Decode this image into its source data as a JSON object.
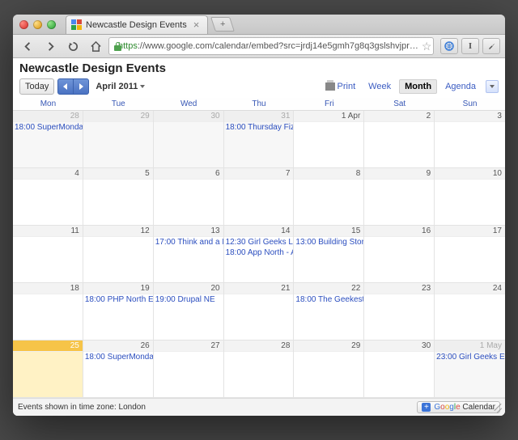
{
  "browser": {
    "tab_title": "Newcastle Design Events",
    "url_scheme": "https",
    "url_rest": "://www.google.com/calendar/embed?src=jrdj14e5gmh7g8q3gslshvjpr…",
    "ext_icons": [
      "globe-icon",
      "serif-i-icon",
      "wrench-icon"
    ]
  },
  "calendar": {
    "title": "Newcastle Design Events",
    "today_label": "Today",
    "month_label": "April 2011",
    "print_label": "Print",
    "views": {
      "week": "Week",
      "month": "Month",
      "agenda": "Agenda"
    },
    "active_view": "Month",
    "dow": [
      "Mon",
      "Tue",
      "Wed",
      "Thu",
      "Fri",
      "Sat",
      "Sun"
    ],
    "footer": "Events shown in time zone: London",
    "gcal_button_word": "Calendar",
    "grid": [
      {
        "date": "28",
        "out": true,
        "today": false,
        "events": [
          {
            "time": "18:00",
            "title": "SuperMonday"
          }
        ]
      },
      {
        "date": "29",
        "out": true,
        "today": false,
        "events": []
      },
      {
        "date": "30",
        "out": true,
        "today": false,
        "events": []
      },
      {
        "date": "31",
        "out": true,
        "today": false,
        "events": [
          {
            "time": "18:00",
            "title": "Thursday Fizz"
          }
        ]
      },
      {
        "date": "1 Apr",
        "out": false,
        "today": false,
        "events": []
      },
      {
        "date": "2",
        "out": false,
        "today": false,
        "events": []
      },
      {
        "date": "3",
        "out": false,
        "today": false,
        "events": []
      },
      {
        "date": "4",
        "out": false,
        "today": false,
        "events": []
      },
      {
        "date": "5",
        "out": false,
        "today": false,
        "events": []
      },
      {
        "date": "6",
        "out": false,
        "today": false,
        "events": []
      },
      {
        "date": "7",
        "out": false,
        "today": false,
        "events": []
      },
      {
        "date": "8",
        "out": false,
        "today": false,
        "events": []
      },
      {
        "date": "9",
        "out": false,
        "today": false,
        "events": []
      },
      {
        "date": "10",
        "out": false,
        "today": false,
        "events": []
      },
      {
        "date": "11",
        "out": false,
        "today": false,
        "events": []
      },
      {
        "date": "12",
        "out": false,
        "today": false,
        "events": []
      },
      {
        "date": "13",
        "out": false,
        "today": false,
        "events": [
          {
            "time": "17:00",
            "title": "Think and a Drink"
          }
        ]
      },
      {
        "date": "14",
        "out": false,
        "today": false,
        "events": [
          {
            "time": "12:30",
            "title": "Girl Geeks Lunch"
          },
          {
            "time": "18:00",
            "title": "App North - A"
          }
        ]
      },
      {
        "date": "15",
        "out": false,
        "today": false,
        "events": [
          {
            "time": "13:00",
            "title": "Building Store"
          }
        ]
      },
      {
        "date": "16",
        "out": false,
        "today": false,
        "events": []
      },
      {
        "date": "17",
        "out": false,
        "today": false,
        "events": []
      },
      {
        "date": "18",
        "out": false,
        "today": false,
        "events": []
      },
      {
        "date": "19",
        "out": false,
        "today": false,
        "events": [
          {
            "time": "18:00",
            "title": "PHP North East"
          }
        ]
      },
      {
        "date": "20",
        "out": false,
        "today": false,
        "events": [
          {
            "time": "19:00",
            "title": "Drupal NE"
          }
        ]
      },
      {
        "date": "21",
        "out": false,
        "today": false,
        "events": []
      },
      {
        "date": "22",
        "out": false,
        "today": false,
        "events": [
          {
            "time": "18:00",
            "title": "The Geekest"
          }
        ]
      },
      {
        "date": "23",
        "out": false,
        "today": false,
        "events": []
      },
      {
        "date": "24",
        "out": false,
        "today": false,
        "events": []
      },
      {
        "date": "25",
        "out": false,
        "today": true,
        "events": []
      },
      {
        "date": "26",
        "out": false,
        "today": false,
        "events": [
          {
            "time": "18:00",
            "title": "SuperMonday"
          }
        ]
      },
      {
        "date": "27",
        "out": false,
        "today": false,
        "events": []
      },
      {
        "date": "28",
        "out": false,
        "today": false,
        "events": []
      },
      {
        "date": "29",
        "out": false,
        "today": false,
        "events": []
      },
      {
        "date": "30",
        "out": false,
        "today": false,
        "events": []
      },
      {
        "date": "1 May",
        "out": true,
        "today": false,
        "events": [
          {
            "time": "23:00",
            "title": "Girl Geeks Event"
          }
        ]
      }
    ]
  }
}
